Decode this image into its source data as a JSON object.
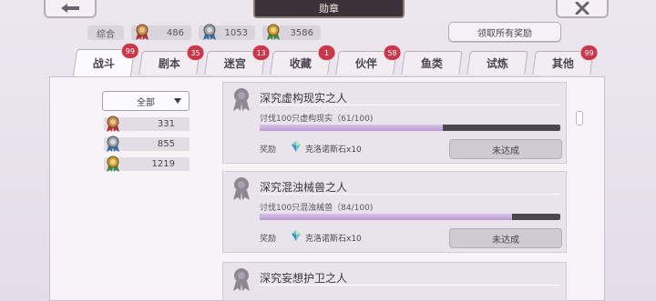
{
  "header": {
    "title": "勋章",
    "back_icon": "back-arrow-icon",
    "close_icon": "close-x-icon"
  },
  "summary": {
    "label": "综合",
    "medals": [
      {
        "tier": "bronze",
        "count": "486"
      },
      {
        "tier": "silver",
        "count": "1053"
      },
      {
        "tier": "gold",
        "count": "3586"
      }
    ],
    "claim_all_label": "领取所有奖励"
  },
  "tabs": [
    {
      "label": "战斗",
      "badge": "99",
      "active": true
    },
    {
      "label": "剧本",
      "badge": "35"
    },
    {
      "label": "迷宫",
      "badge": "13"
    },
    {
      "label": "收藏",
      "badge": "1"
    },
    {
      "label": "伙伴",
      "badge": "58"
    },
    {
      "label": "鱼类",
      "badge": ""
    },
    {
      "label": "试炼",
      "badge": ""
    },
    {
      "label": "其他",
      "badge": "99"
    }
  ],
  "filter": {
    "selected": "全部"
  },
  "counts": [
    {
      "tier": "bronze",
      "value": "331"
    },
    {
      "tier": "silver",
      "value": "855"
    },
    {
      "tier": "gold",
      "value": "1219"
    }
  ],
  "achievements": [
    {
      "title": "深究虚构现实之人",
      "desc": "讨伐100只虚构现实（61/100)",
      "progress": 0.61,
      "reward_label": "奖励",
      "reward": "克洛诺斯石x10",
      "status": "未达成"
    },
    {
      "title": "深究混浊械兽之人",
      "desc": "讨伐100只混浊械兽（84/100)",
      "progress": 0.84,
      "reward_label": "奖励",
      "reward": "克洛诺斯石x10",
      "status": "未达成"
    },
    {
      "title": "深究妄想护卫之人"
    }
  ],
  "colors": {
    "badge": "#c8374a",
    "progress_fill": "#c4a8dc",
    "progress_track": "#4c464f",
    "title_plate": "#3b3136"
  }
}
